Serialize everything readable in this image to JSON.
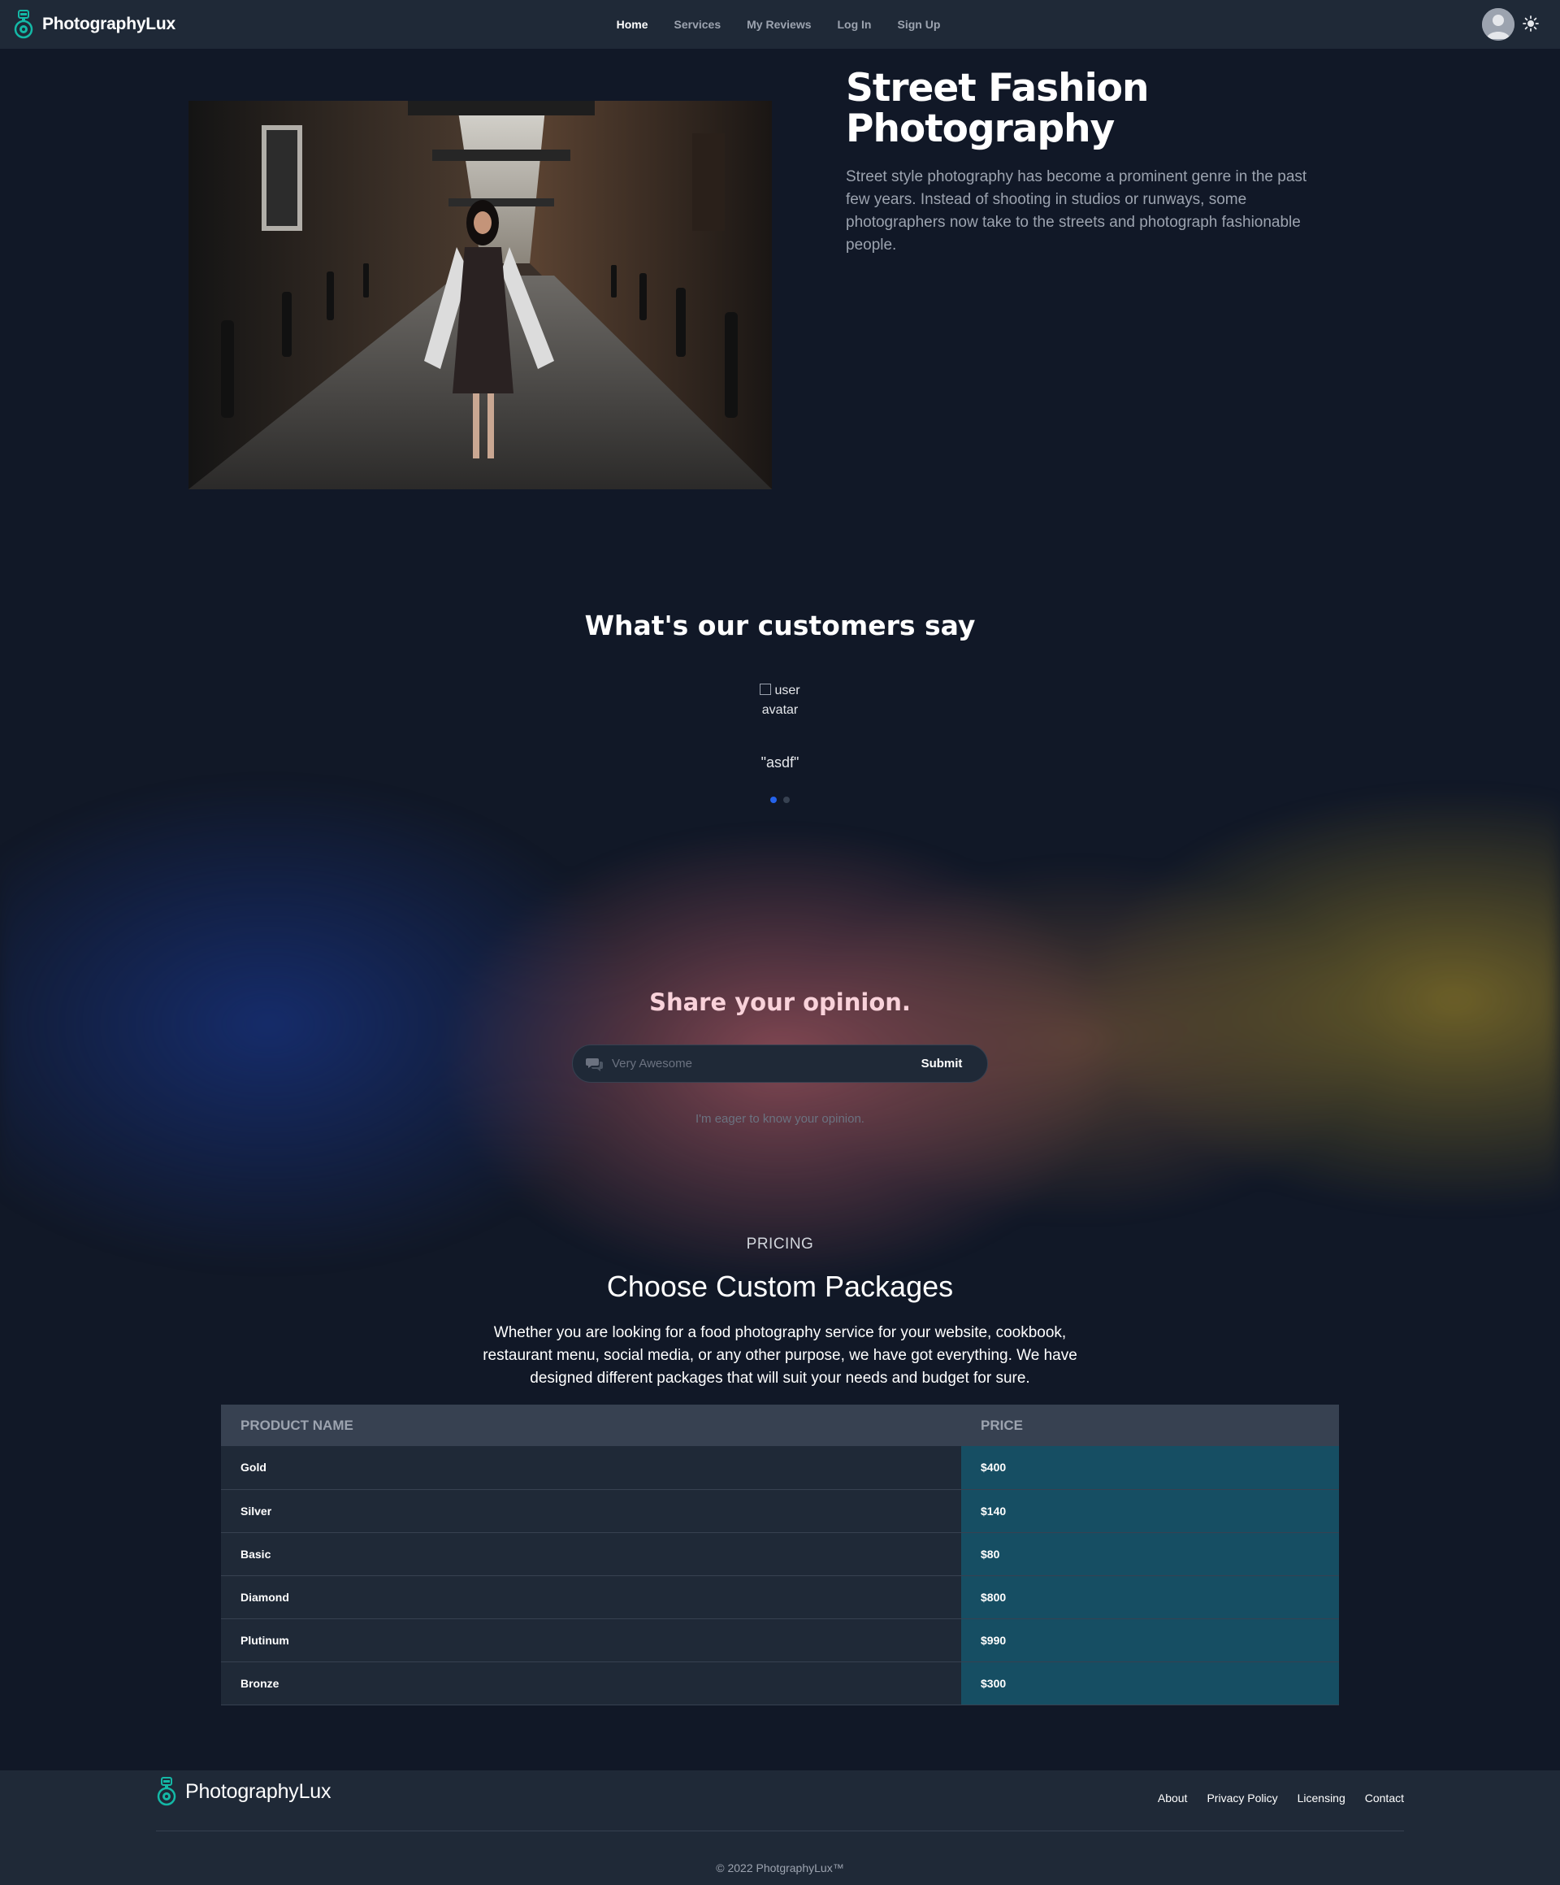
{
  "navbar": {
    "brand": "PhotographyLux",
    "links": [
      "Home",
      "Services",
      "My Reviews",
      "Log In",
      "Sign Up"
    ],
    "active_link": "Home"
  },
  "hero": {
    "title": "Street Fashion Photography",
    "description": "Street style photography has become a prominent genre in the past few years. Instead of shooting in studios or runways, some photographers now take to the streets and photograph fashionable people."
  },
  "testimonials": {
    "title": "What's our customers say",
    "avatar_alt": "user avatar",
    "quote": "\"asdf\"",
    "slide_count": 2,
    "active_slide": 1
  },
  "opinion": {
    "title": "Share your opinion.",
    "input_value": "",
    "placeholder": "Very Awesome",
    "submit_label": "Submit",
    "hint": "I'm eager to know your opinion."
  },
  "pricing": {
    "eyebrow": "PRICING",
    "title": "Choose Custom Packages",
    "description": "Whether you are looking for a food photography service for your website, cookbook, restaurant menu, social media, or any other purpose, we have got everything. We have designed different packages that will suit your needs and budget for sure.",
    "columns": [
      "PRODUCT NAME",
      "PRICE"
    ],
    "rows": [
      {
        "name": "Gold",
        "price": "$400"
      },
      {
        "name": "Silver",
        "price": "$140"
      },
      {
        "name": "Basic",
        "price": "$80"
      },
      {
        "name": "Diamond",
        "price": "$800"
      },
      {
        "name": "Plutinum",
        "price": "$990"
      },
      {
        "name": "Bronze",
        "price": "$300"
      }
    ]
  },
  "footer": {
    "brand": "PhotographyLux",
    "links": [
      "About",
      "Privacy Policy",
      "Licensing",
      "Contact"
    ],
    "copyright": "© 2022 PhotgraphyLux™"
  },
  "colors": {
    "background": "#111827",
    "navbar": "#1f2937",
    "accent_teal": "#14b8a6",
    "price_column": "#164e63",
    "carousel_active": "#2563eb"
  },
  "icons": {
    "brand_logo": "camera-logo-icon",
    "avatar": "user-avatar-icon",
    "theme_toggle": "sun-icon",
    "chat": "chat-bubbles-icon"
  }
}
